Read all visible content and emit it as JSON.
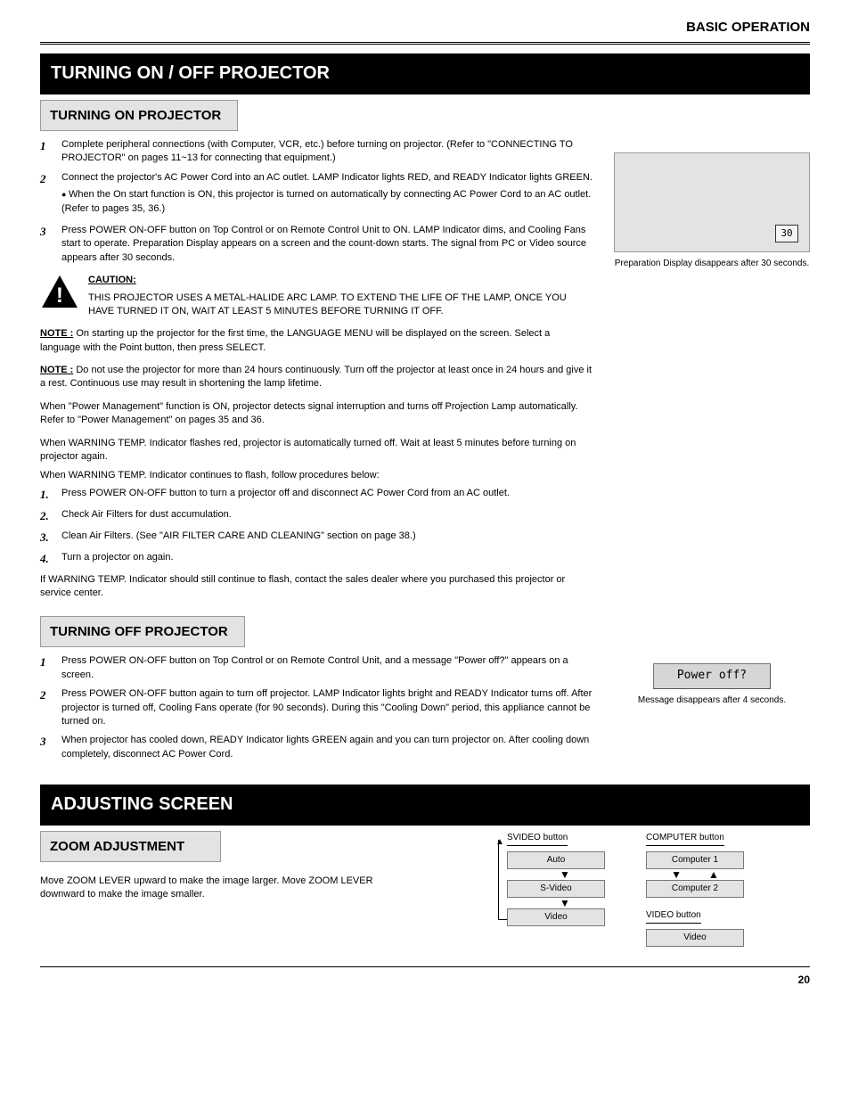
{
  "header": {
    "breadcrumb": "BASIC OPERATION"
  },
  "sec1": {
    "bar": "TURNING ON / OFF PROJECTOR",
    "on": {
      "heading": "TURNING ON PROJECTOR",
      "steps": [
        "Complete peripheral connections (with Computer, VCR, etc.) before turning on projector. (Refer to \"CONNECTING TO PROJECTOR\" on pages 11~13 for connecting that equipment.)",
        "Connect the projector's AC Power Cord into an AC outlet. LAMP Indicator lights RED, and READY Indicator lights GREEN.",
        "Press POWER ON-OFF button on Top Control or on Remote Control Unit to ON. LAMP Indicator dims, and Cooling Fans start to operate. Preparation Display appears on a screen and the count-down starts. The signal from PC or Video source appears after 30 seconds."
      ],
      "step2_bullets": [
        "When the On start function is ON, this projector is turned on automatically by connecting AC Power Cord to an AC outlet. (Refer to pages 35, 36.)"
      ],
      "note_label": "NOTE :",
      "note_text": "On starting up the projector for the first time, the LANGUAGE MENU will be displayed on the screen. Select a language with the Point button, then press SELECT.",
      "caution_title": "CAUTION:",
      "caution_text": "THIS PROJECTOR USES A METAL-HALIDE ARC LAMP. TO EXTEND THE LIFE OF THE LAMP, ONCE YOU HAVE TURNED IT ON, WAIT AT LEAST 5 MINUTES BEFORE TURNING IT OFF.",
      "prep_timer": "30",
      "prep_caption1": "Preparation Display disappears after 30 seconds.",
      "prep_caption2": ""
    },
    "off": {
      "heading": "TURNING OFF PROJECTOR",
      "steps": [
        "Press POWER ON-OFF button on Top Control or on Remote Control Unit, and a message \"Power off?\" appears on a screen.",
        "Press POWER ON-OFF button again to turn off projector. LAMP Indicator lights bright and READY Indicator turns off. After projector is turned off, Cooling Fans operate (for 90 seconds). During this \"Cooling Down\" period, this appliance cannot be turned on.",
        "When projector has cooled down, READY Indicator lights GREEN again and you can turn projector on. After cooling down completely, disconnect AC Power Cord."
      ],
      "power_off_label": "Power off?",
      "po_caption": "Message disappears after 4 seconds."
    },
    "note2_label": "NOTE :",
    "note2_text": "Do not use the projector for more than 24 hours continuously. Turn off the projector at least once in 24 hours and give it a rest. Continuous use may result in shortening the lamp lifetime.",
    "ready_text": "When \"Power Management\" function is ON, projector detects signal interruption and turns off Projection Lamp automatically. Refer to \"Power Management\" on pages 35 and 36.",
    "temp_intro": "When WARNING TEMP. Indicator flashes red, projector is automatically turned off. Wait at least 5 minutes before turning on projector again.",
    "temp_again": "When WARNING TEMP. Indicator continues to flash, follow procedures below:",
    "temp_steps": [
      "Press POWER ON-OFF button to turn a projector off and disconnect AC Power Cord from an AC outlet.",
      "Check Air Filters for dust accumulation.",
      "Clean Air Filters. (See \"AIR FILTER CARE AND CLEANING\" section on page 38.)",
      "Turn a projector on again."
    ],
    "temp_tail": "If WARNING TEMP. Indicator should still continue to flash, contact the sales dealer where you purchased this projector or service center."
  },
  "sec2": {
    "bar": "ADJUSTING SCREEN",
    "zoom": {
      "heading": "ZOOM ADJUSTMENT",
      "text": "Move ZOOM LEVER upward to make the image larger. Move ZOOM LEVER downward to make the image smaller."
    },
    "diagrams": {
      "svideo_title": "SVIDEO button",
      "svideo_boxes": [
        "Auto",
        "S-Video",
        "Video"
      ],
      "computer_title": "COMPUTER button",
      "computer_boxes": [
        "Computer 1",
        "Computer 2"
      ],
      "video_title": "VIDEO button",
      "video_boxes": [
        "Video"
      ]
    }
  },
  "footer": {
    "page": "20"
  }
}
